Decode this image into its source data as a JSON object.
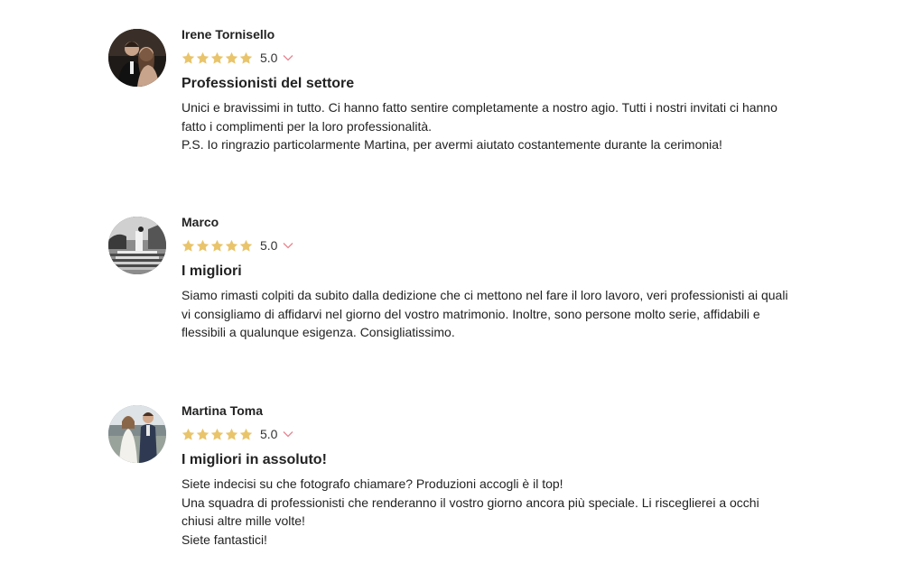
{
  "reviews": [
    {
      "author": "Irene Tornisello",
      "rating": 5,
      "rating_label": "5.0",
      "title": "Professionisti del settore",
      "text": "Unici e bravissimi in tutto. Ci hanno fatto sentire completamente a nostro agio. Tutti i nostri invitati ci hanno\nfatto i complimenti per la loro professionalità.\nP.S. Io ringrazio particolarmente Martina, per avermi aiutato costantemente durante la cerimonia!"
    },
    {
      "author": "Marco",
      "rating": 5,
      "rating_label": "5.0",
      "title": "I migliori",
      "text": "Siamo rimasti colpiti da subito dalla dedizione che ci mettono nel fare il loro lavoro, veri professionisti ai quali\nvi consigliamo di affidarvi nel giorno del vostro matrimonio. Inoltre, sono persone molto serie, affidabili e\nflessibili a qualunque esigenza. Consigliatissimo."
    },
    {
      "author": "Martina Toma",
      "rating": 5,
      "rating_label": "5.0",
      "title": "I migliori in assoluto!",
      "text": "Siete indecisi su che fotografo chiamare? Produzioni accogli è il top!\nUna squadra di professionisti che renderanno il vostro giorno ancora più speciale. Li risceglierei a occhi\nchiusi altre mille volte!\nSiete fantastici!"
    }
  ],
  "colors": {
    "star": "#e9c46a",
    "toggle": "#e8848f",
    "text": "#222222"
  },
  "icons": {
    "star": "star-icon",
    "toggle": "chevron-down-icon"
  }
}
